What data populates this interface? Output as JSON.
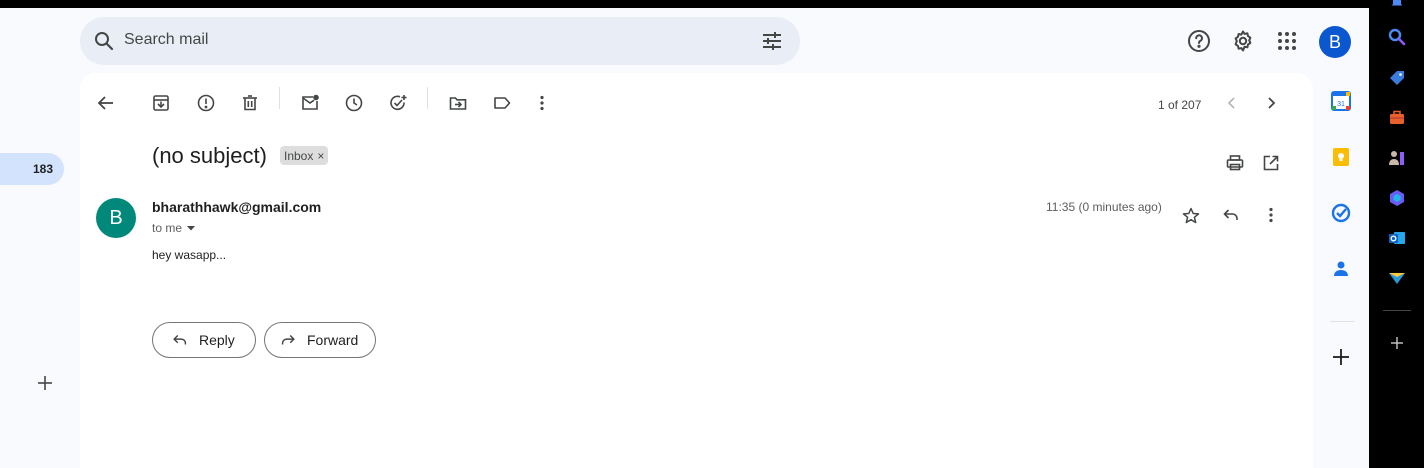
{
  "search": {
    "placeholder": "Search mail"
  },
  "header": {
    "avatar_letter": "B"
  },
  "nav": {
    "unread_count": "183"
  },
  "toolbar": {
    "pager_text": "1 of 207"
  },
  "email": {
    "subject": "(no subject)",
    "label_chip": "Inbox",
    "sender_letter": "B",
    "sender": "bharathhawk@gmail.com",
    "recipient": "to me",
    "timestamp": "11:35 (0 minutes ago)",
    "body": "hey wasapp...",
    "reply_label": "Reply",
    "forward_label": "Forward"
  },
  "side_panel": {
    "calendar_day": "31",
    "colors": {
      "calendar": "#1a73e8",
      "keep": "#fbbc04",
      "tasks": "#1a73e8",
      "contacts": "#1a73e8"
    }
  },
  "colors": {
    "accent": "#0b57d0",
    "sender_avatar": "#00897b",
    "app_bg": "#f8fafd",
    "search_bg": "#e9eef6"
  }
}
